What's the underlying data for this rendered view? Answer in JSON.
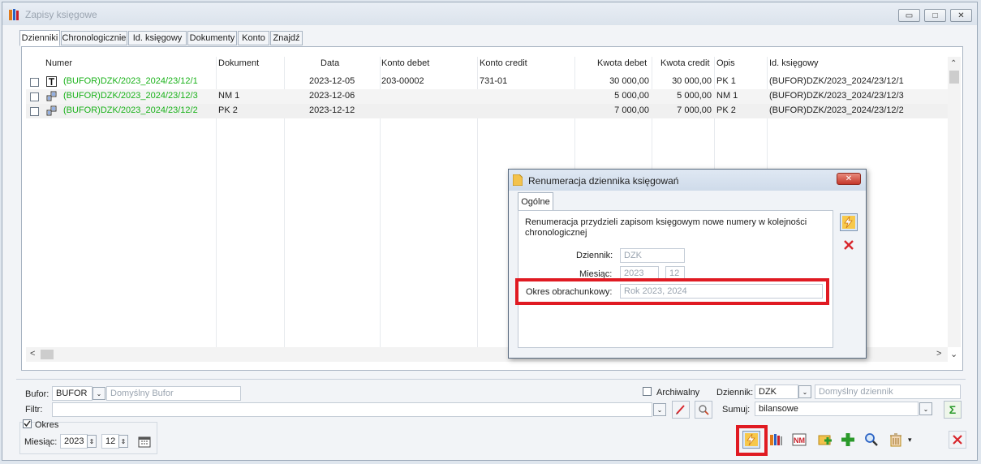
{
  "window": {
    "title": "Zapisy księgowe"
  },
  "tabs": [
    "Dzienniki",
    "Chronologicznie",
    "Id. księgowy",
    "Dokumenty",
    "Konto",
    "Znajdź"
  ],
  "table": {
    "headers": [
      "Numer",
      "Dokument",
      "Data",
      "Konto debet",
      "Konto credit",
      "Kwota debet",
      "Kwota credit",
      "Opis",
      "Id. księgowy"
    ],
    "rows": [
      {
        "numer": "(BUFOR)DZK/2023_2024/23/12/1",
        "dokument": "",
        "data": "2023-12-05",
        "konto_debet": "203-00002",
        "konto_credit": "731-01",
        "kwota_debet": "30 000,00",
        "kwota_credit": "30 000,00",
        "opis": "PK 1",
        "id": "(BUFOR)DZK/2023_2024/23/12/1",
        "icon": "text-t-icon"
      },
      {
        "numer": "(BUFOR)DZK/2023_2024/23/12/3",
        "dokument": "NM 1",
        "data": "2023-12-06",
        "konto_debet": "",
        "konto_credit": "",
        "kwota_debet": "5 000,00",
        "kwota_credit": "5 000,00",
        "opis": "NM 1",
        "id": "(BUFOR)DZK/2023_2024/23/12/3",
        "icon": "split-entries-icon"
      },
      {
        "numer": "(BUFOR)DZK/2023_2024/23/12/2",
        "dokument": "PK 2",
        "data": "2023-12-12",
        "konto_debet": "",
        "konto_credit": "",
        "kwota_debet": "7 000,00",
        "kwota_credit": "7 000,00",
        "opis": "PK 2",
        "id": "(BUFOR)DZK/2023_2024/23/12/2",
        "icon": "split-entries-icon"
      }
    ]
  },
  "dialog": {
    "title": "Renumeracja dziennika księgowań",
    "tab": "Ogólne",
    "description": "Renumeracja przydzieli zapisom księgowym nowe numery w kolejności chronologicznej",
    "dziennik_label": "Dziennik:",
    "dziennik_value": "DZK",
    "miesiac_label": "Miesiąc:",
    "year_value": "2023",
    "month_value": "12",
    "okres_label": "Okres obrachunkowy:",
    "okres_value": "Rok 2023, 2024"
  },
  "bottom": {
    "bufor_label": "Bufor:",
    "bufor_value": "BUFOR",
    "bufor_desc": "Domyślny Bufor",
    "filtr_label": "Filtr:",
    "archiwalny_label": "Archiwalny",
    "dziennik_label": "Dziennik:",
    "dziennik_value": "DZK",
    "dziennik_desc": "Domyślny dziennik",
    "sumuj_label": "Sumuj:",
    "sumuj_value": "bilansowe",
    "okres_label": "Okres",
    "miesiac_label": "Miesiąc:",
    "year": "2023",
    "month": "12"
  },
  "colors": {
    "accent_red": "#e01a22",
    "green_text": "#1ab21a"
  }
}
